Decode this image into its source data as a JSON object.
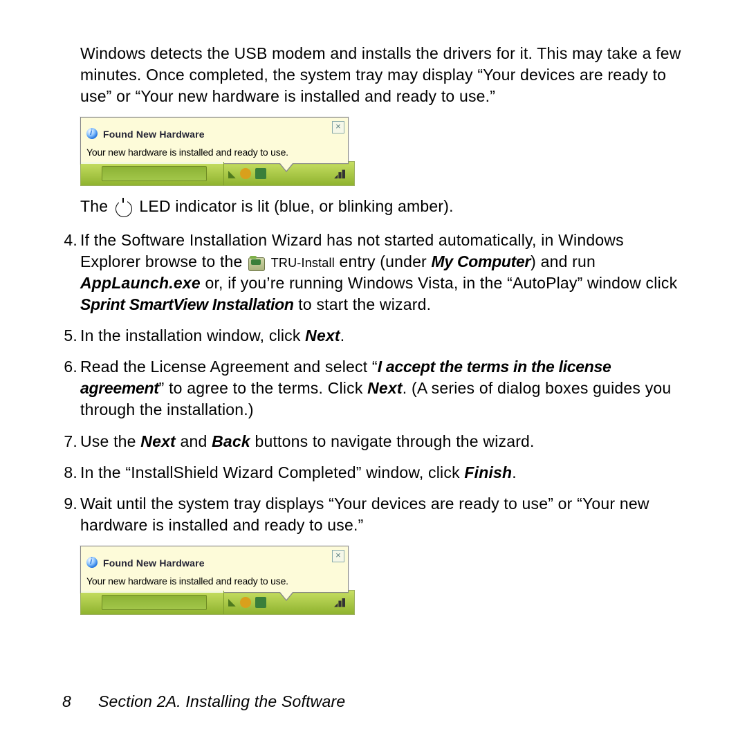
{
  "intro": "Windows detects the USB modem and installs the drivers for it. This may take a few minutes. Once completed, the system tray may display “Your devices are ready to use” or “Your new hardware is installed and ready to use.”",
  "balloon": {
    "title": "Found New Hardware",
    "message": "Your new hardware is installed and ready to use.",
    "close": "×"
  },
  "led": {
    "before": "The ",
    "after": " LED indicator is lit (blue, or blinking amber)."
  },
  "steps": {
    "s4": {
      "num": "4.",
      "a": "If the Software Installation Wizard has not started automatically, in Windows Explorer browse to the ",
      "tru": "TRU-Install",
      "b": " entry (under ",
      "myc": "My Computer",
      "c": ") and run ",
      "app": "AppLaunch.exe",
      "d": " or, if you’re running Windows Vista, in the “AutoPlay” window click ",
      "inst": "Sprint SmartView Installation",
      "e": " to start the wizard."
    },
    "s5": {
      "num": "5.",
      "a": "In the installation window, click ",
      "next": "Next",
      "b": "."
    },
    "s6": {
      "num": "6.",
      "a": "Read the License Agreement and select “",
      "accept": "I accept the terms in the license agreement",
      "b": "” to agree to the terms. Click ",
      "next": "Next",
      "c": ". (A series of dialog boxes guides you through the installation.)"
    },
    "s7": {
      "num": "7.",
      "a": "Use the ",
      "next": "Next",
      "b": " and ",
      "back": "Back",
      "c": " buttons to navigate through the wizard."
    },
    "s8": {
      "num": "8.",
      "a": "In the “InstallShield Wizard Completed” window, click ",
      "finish": "Finish",
      "b": "."
    },
    "s9": {
      "num": "9.",
      "a": "Wait until the system tray displays “Your devices are ready to use” or “Your new hardware is installed and ready to use.”"
    }
  },
  "footer": {
    "page": "8",
    "section": "Section 2A. Installing the Software"
  }
}
